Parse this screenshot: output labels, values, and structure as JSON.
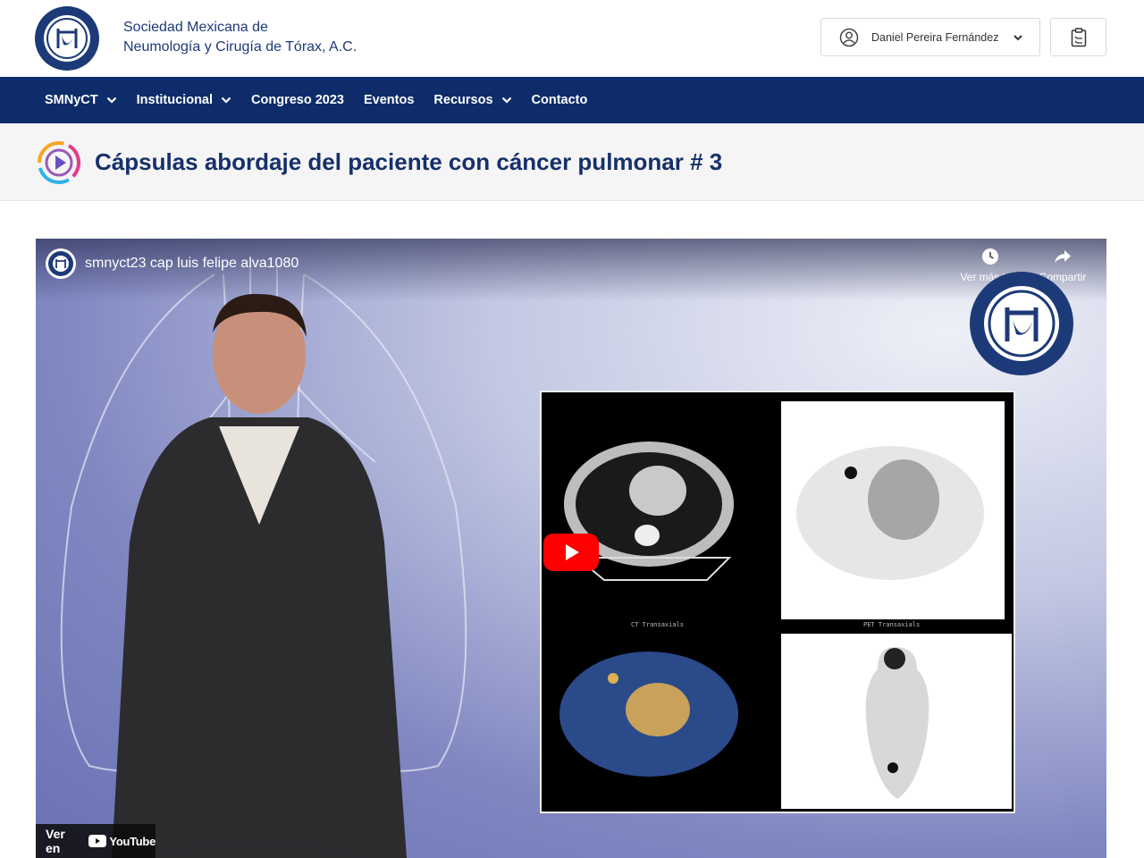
{
  "header": {
    "org_name_line1": "Sociedad Mexicana de",
    "org_name_line2": "Neumología y Cirugía de Tórax, A.C.",
    "user_name": "Daniel Pereira Fernández"
  },
  "nav": {
    "items": [
      {
        "label": "SMNyCT",
        "dropdown": true
      },
      {
        "label": "Institucional",
        "dropdown": true
      },
      {
        "label": "Congreso 2023",
        "dropdown": false
      },
      {
        "label": "Eventos",
        "dropdown": false
      },
      {
        "label": "Recursos",
        "dropdown": true
      },
      {
        "label": "Contacto",
        "dropdown": false
      }
    ]
  },
  "page": {
    "title": "Cápsulas abordaje del paciente con cáncer pulmonar # 3"
  },
  "video": {
    "title": "smnyct23 cap luis felipe alva1080",
    "watch_later_label": "Ver más ta...",
    "share_label": "Compartir",
    "watch_on_label": "Ver en",
    "youtube_label": "YouTube",
    "scan_labels": {
      "ct": "CT Transaxials",
      "pet": "PET Transaxials"
    }
  },
  "colors": {
    "nav_bg": "#0e2c6a",
    "title_text": "#16306a",
    "youtube_red": "#ff0000"
  }
}
